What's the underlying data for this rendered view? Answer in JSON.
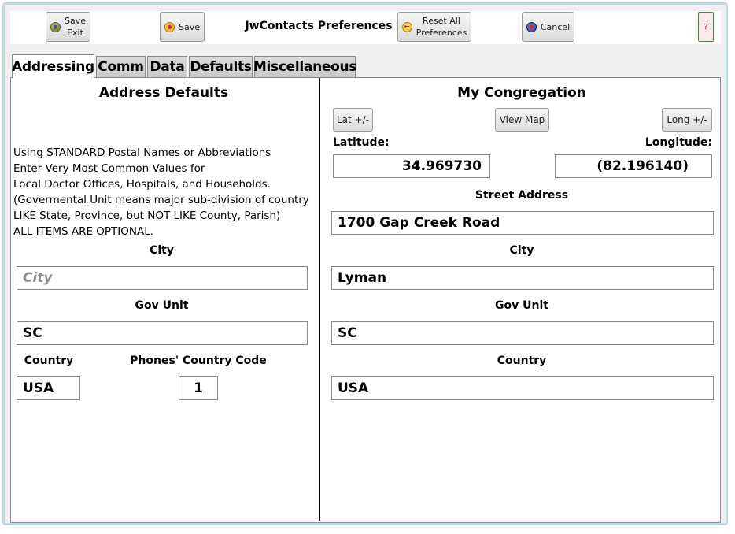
{
  "window": {
    "title": "JwContacts Preferences"
  },
  "toolbar": {
    "save_exit_lines": [
      "Save",
      "Exit"
    ],
    "save_label": "Save",
    "reset_lines": [
      "Reset All",
      "Preferences"
    ],
    "cancel_label": "Cancel",
    "help_label": "?"
  },
  "tabs": [
    {
      "label": "Addressing",
      "active": true
    },
    {
      "label": "Comm",
      "active": false
    },
    {
      "label": "Data",
      "active": false
    },
    {
      "label": "Defaults",
      "active": false
    },
    {
      "label": "Miscellaneous",
      "active": false
    }
  ],
  "address_defaults": {
    "heading": "Address Defaults",
    "instructions": [
      "Using STANDARD Postal Names or Abbreviations",
      "Enter Very Most Common Values for",
      "Local Doctor Offices, Hospitals, and Households.",
      "(Govermental Unit means major sub-division of country",
      "LIKE State, Province, but NOT LIKE County, Parish)",
      "ALL ITEMS ARE OPTIONAL."
    ],
    "city_label": "City",
    "city_value": "",
    "city_placeholder": "City",
    "gov_unit_label": "Gov Unit",
    "gov_unit_value": "SC",
    "country_label": "Country",
    "country_value": "USA",
    "phone_code_label": "Phones' Country Code",
    "phone_code_value": "1"
  },
  "my_congregation": {
    "heading": "My Congregation",
    "lat_button": "Lat +/-",
    "view_map_button": "View Map",
    "long_button": "Long +/-",
    "latitude_label": "Latitude:",
    "latitude_value": "34.969730",
    "longitude_label": "Longitude:",
    "longitude_value": "(82.196140)",
    "street_label": "Street Address",
    "street_value": "1700 Gap Creek Road",
    "city_label": "City",
    "city_value": "Lyman",
    "gov_unit_label": "Gov Unit",
    "gov_unit_value": "SC",
    "country_label": "Country",
    "country_value": "USA"
  },
  "colors": {
    "window_border": "#b9dbe8",
    "help_border": "#3b8f3b",
    "help_bg": "#fbeaea"
  }
}
